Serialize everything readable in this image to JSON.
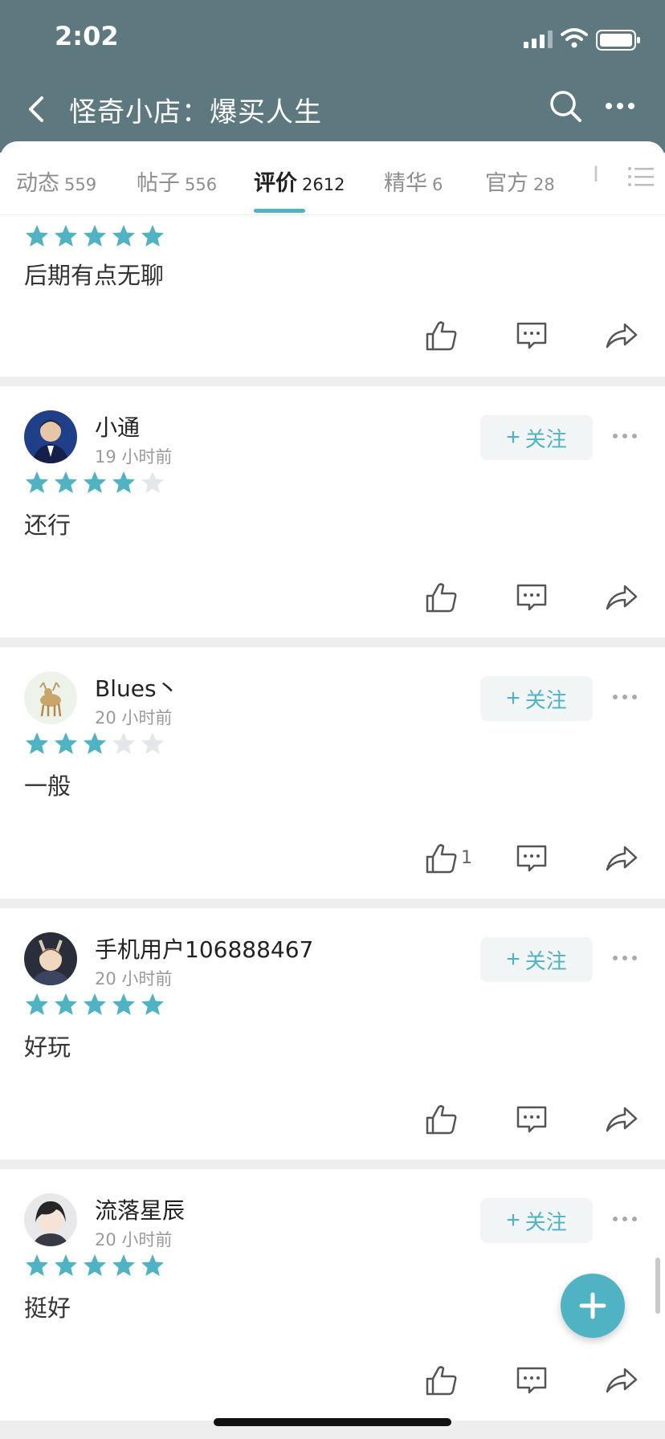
{
  "status": {
    "time": "2:02"
  },
  "nav": {
    "title": "怪奇小店：爆买人生"
  },
  "tabs": [
    {
      "label": "动态",
      "count": "559"
    },
    {
      "label": "帖子",
      "count": "556"
    },
    {
      "label": "评价",
      "count": "2612",
      "active": true
    },
    {
      "label": "精华",
      "count": "6"
    },
    {
      "label": "官方",
      "count": "28"
    },
    {
      "label": "I"
    }
  ],
  "reviews": [
    {
      "rating": 5,
      "content": "后期有点无聊"
    },
    {
      "name": "小通",
      "time": "19 小时前",
      "rating": 4,
      "content": "还行",
      "follow": "关注"
    },
    {
      "name": "Blues丶",
      "time": "20 小时前",
      "rating": 3,
      "content": "一般",
      "likes": "1",
      "follow": "关注"
    },
    {
      "name": "手机用户106888467",
      "time": "20 小时前",
      "rating": 5,
      "content": "好玩",
      "follow": "关注"
    },
    {
      "name": "流落星辰",
      "time": "20 小时前",
      "rating": 5,
      "content": "挺好",
      "follow": "关注"
    }
  ],
  "colors": {
    "header": "#5e7880",
    "accent": "#4fb3c4"
  }
}
